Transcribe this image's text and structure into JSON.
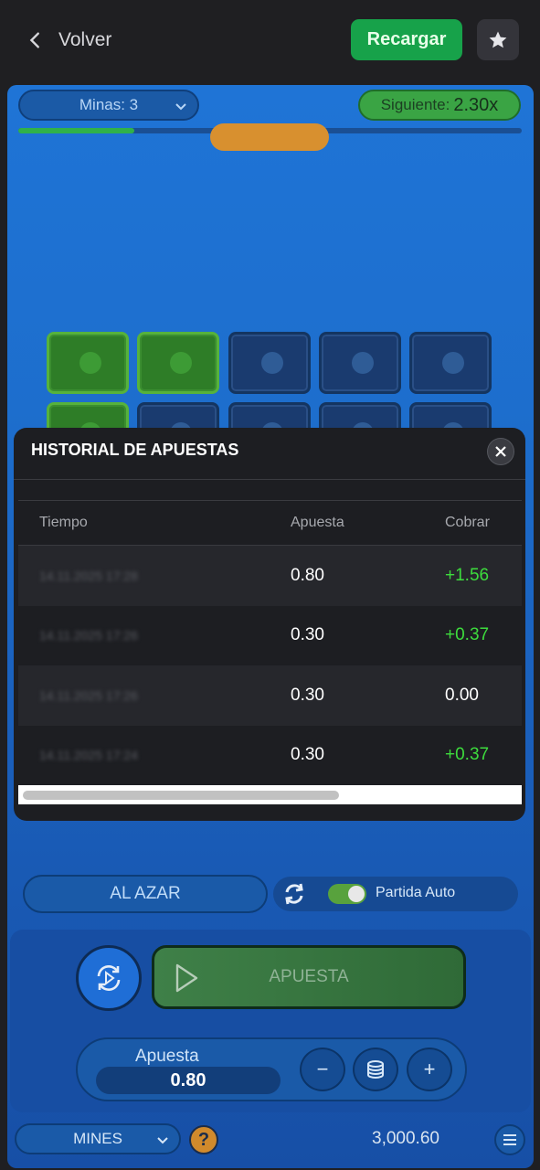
{
  "topbar": {
    "back_label": "Volver",
    "reload_label": "Recargar"
  },
  "game": {
    "mines_label": "Minas: 3",
    "next_label": "Siguiente:",
    "next_multiplier": "2.30x",
    "progress_fraction": 0.23
  },
  "history": {
    "title": "HISTORIAL DE APUESTAS",
    "columns": {
      "time": "Tiempo",
      "bet": "Apuesta",
      "cashout": "Cobrar"
    },
    "rows": [
      {
        "time": "14.11.2025 17:28",
        "bet": "0.80",
        "cashout": "+1.56"
      },
      {
        "time": "14.11.2025 17:26",
        "bet": "0.30",
        "cashout": "+0.37"
      },
      {
        "time": "14.11.2025 17:26",
        "bet": "0.30",
        "cashout": "0.00"
      },
      {
        "time": "14.11.2025 17:24",
        "bet": "0.30",
        "cashout": "+0.37"
      }
    ]
  },
  "controls": {
    "random_label": "AL AZAR",
    "auto_label": "Partida Auto",
    "bet_button_label": "APUESTA",
    "bet_label": "Apuesta",
    "bet_value": "0.80",
    "minus": "−",
    "plus": "+"
  },
  "footer": {
    "game_label": "MINES",
    "help_label": "?",
    "balance": "3,000.60"
  },
  "colors": {
    "accent_green": "#17a24a",
    "win_green": "#3ddc3d",
    "game_blue": "#1f74d6",
    "knob_orange": "#d8902f"
  }
}
